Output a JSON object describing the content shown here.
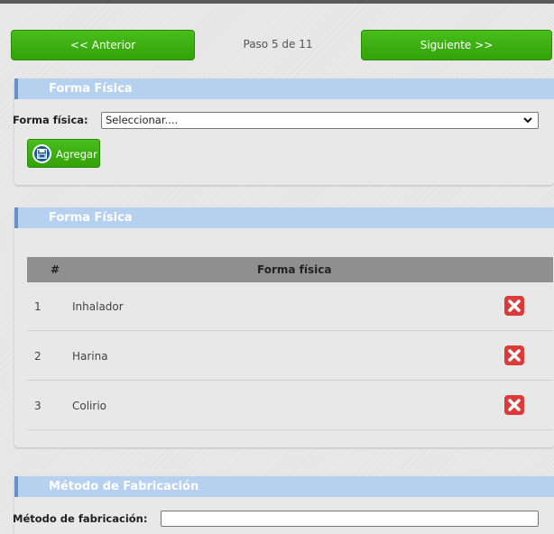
{
  "nav": {
    "prev_label": "<< Anterior",
    "step_text": "Paso 5 de 11",
    "next_label": "Siguiente >>"
  },
  "section1": {
    "title": "Forma Física",
    "field_label": "Forma física:",
    "select_value": "Seleccionar....",
    "add_label": "Agregar"
  },
  "section2": {
    "title": "Forma Física",
    "table": {
      "headers": [
        "#",
        "Forma física"
      ],
      "rows": [
        {
          "num": "1",
          "name": "Inhalador"
        },
        {
          "num": "2",
          "name": "Harina"
        },
        {
          "num": "3",
          "name": "Colirio"
        }
      ]
    }
  },
  "section3": {
    "title": "Método de Fabricación",
    "field_label": "Método de fabricación:",
    "input_value": ""
  },
  "colors": {
    "green_button": "#3aab10",
    "header_blue": "#b6d0f0",
    "delete_red": "#dc3b3b"
  },
  "icons": {
    "add": "floppy-disk-icon",
    "delete": "close-x-icon",
    "select": "chevron-down-icon"
  }
}
